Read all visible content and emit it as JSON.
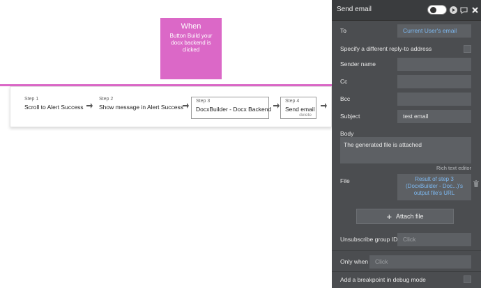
{
  "event": {
    "title": "When",
    "description": "Button Build your docx backend is clicked"
  },
  "steps": [
    {
      "num": "Step 1",
      "name": "Scroll to Alert Success"
    },
    {
      "num": "Step 2",
      "name": "Show message in Alert Success"
    },
    {
      "num": "Step 3",
      "name": "DocxBuilder - Docx Backend"
    },
    {
      "num": "Step 4",
      "name": "Send email",
      "delete": "delete"
    }
  ],
  "panel": {
    "title": "Send email",
    "icons": [
      "toggle-icon",
      "play-icon",
      "comment-icon",
      "close-icon"
    ],
    "to_label": "To",
    "to_value": "Current User's email",
    "reply_to_label": "Specify a different reply-to address",
    "sender_label": "Sender name",
    "sender_value": "",
    "cc_label": "Cc",
    "cc_value": "",
    "bcc_label": "Bcc",
    "bcc_value": "",
    "subject_label": "Subject",
    "subject_value": "test email",
    "body_label": "Body",
    "body_value": "The generated file is attached",
    "rich_text_editor": "Rich text editor",
    "file_label": "File",
    "file_value": "Result of step 3 (DocxBuilder - Doc...)'s output file's URL",
    "attach_label": "Attach file",
    "unsubscribe_label": "Unsubscribe group ID",
    "unsubscribe_placeholder": "Click",
    "only_when_label": "Only when",
    "only_when_placeholder": "Click",
    "breakpoint_label": "Add a breakpoint in debug mode"
  },
  "colors": {
    "event_pink": "#db68c7",
    "panel_bg": "#4b4d50",
    "field_bg": "#5d6064",
    "link_blue": "#7db8f0"
  }
}
